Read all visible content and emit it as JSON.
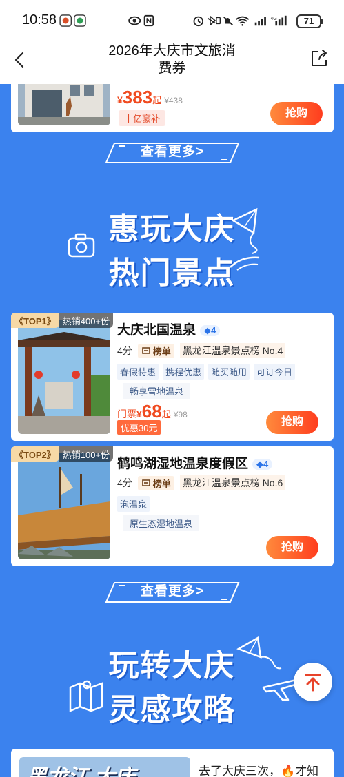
{
  "status": {
    "time": "10:58",
    "battery": "71",
    "network_label": "4G"
  },
  "header": {
    "title_line1": "2026年大庆市文旅消",
    "title_line2": "费券"
  },
  "top_card": {
    "yen": "¥",
    "price": "383",
    "qi": "起",
    "original": "¥438",
    "subsidy": "十亿豪补",
    "buy_label": "抢购"
  },
  "see_more_1": "查看更多>",
  "hero1": {
    "line1": "惠玩大庆",
    "line2": "热门景点"
  },
  "products": [
    {
      "top_rank": "《TOP1》",
      "hot": "热销400+份",
      "title": "大庆北国温泉",
      "level": "4",
      "score": "4分",
      "rank_badge": "榜单",
      "rank_text": "黑龙江温泉景点榜 No.4",
      "tags": [
        "春假特惠",
        "携程优惠",
        "随买随用",
        "可订今日"
      ],
      "features": [
        "畅享雪地温泉"
      ],
      "ticket_label": "门票",
      "yen": "¥",
      "price": "68",
      "qi": "起",
      "original": "¥98",
      "discount": "优惠30元",
      "buy_label": "抢购"
    },
    {
      "top_rank": "《TOP2》",
      "hot": "热销100+份",
      "title": "鹤鸣湖湿地温泉度假区",
      "level": "4",
      "score": "4分",
      "rank_badge": "榜单",
      "rank_text": "黑龙江温泉景点榜 No.6",
      "tags": [
        "泡温泉"
      ],
      "features": [
        "原生态湿地温泉"
      ],
      "buy_label": "抢购"
    }
  ],
  "see_more_2": "查看更多>",
  "hero2": {
    "line1": "玩转大庆",
    "line2": "灵感攻略"
  },
  "bottom_card": {
    "image_text": "黑龙江 大庆",
    "text": "去了大庆三次，🔥才知"
  },
  "colors": {
    "background": "#3b82ee",
    "price": "#f04a1f",
    "buy_gradient_start": "#ff8a3c",
    "buy_gradient_end": "#ff3d1e"
  }
}
